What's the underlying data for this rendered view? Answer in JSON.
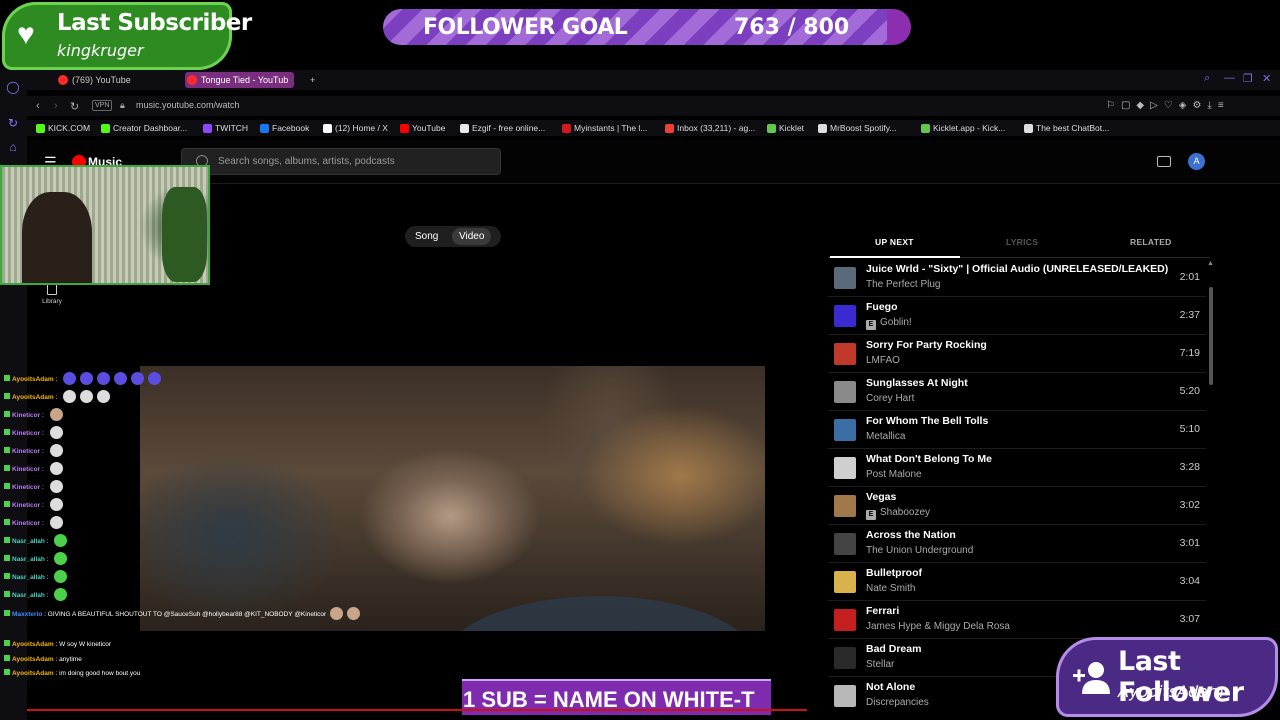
{
  "overlay": {
    "subscriber": {
      "title": "Last Subscriber",
      "name": "kingkruger"
    },
    "goal": {
      "title": "FOLLOWER GOAL",
      "current": 763,
      "target": 800,
      "count_text": "763 / 800"
    },
    "follower": {
      "title": "Last Follower",
      "name": "AyooitsAdam"
    },
    "banner": "1 SUB = NAME ON WHITE-T"
  },
  "browser": {
    "tabs": [
      {
        "label": "(769) YouTube",
        "active": false
      },
      {
        "label": "Tongue Tied - YouTub",
        "active": true
      }
    ],
    "url": "music.youtube.com/watch",
    "vpn": "VPN",
    "bookmarks": [
      {
        "label": "KICK.COM",
        "color": "#53fc18"
      },
      {
        "label": "Creator Dashboar...",
        "color": "#53fc18"
      },
      {
        "label": "TWITCH",
        "color": "#9146ff"
      },
      {
        "label": "Facebook",
        "color": "#1877f2"
      },
      {
        "label": "(12) Home / X",
        "color": "#ffffff"
      },
      {
        "label": "YouTube",
        "color": "#ff0000"
      },
      {
        "label": "Ezgif - free online...",
        "color": "#e9e9e9"
      },
      {
        "label": "Myinstants | The l...",
        "color": "#d11a1a"
      },
      {
        "label": "Inbox (33,211) - ag...",
        "color": "#ea4335"
      },
      {
        "label": "Kicklet",
        "color": "#63c74d"
      },
      {
        "label": "MrBoost Spotify...",
        "color": "#dddddd"
      },
      {
        "label": "Kicklet.app - Kick...",
        "color": "#63c74d"
      },
      {
        "label": "The best ChatBot...",
        "color": "#dddddd"
      }
    ]
  },
  "ytmusic": {
    "logo": "Music",
    "search_placeholder": "Search songs, albums, artists, podcasts",
    "avatar_letter": "A",
    "library": "Library",
    "toggle": {
      "song": "Song",
      "video": "Video",
      "selected": "Video"
    },
    "panel_tabs": [
      "UP NEXT",
      "LYRICS",
      "RELATED"
    ],
    "queue": [
      {
        "title": "Juice Wrld - \"Sixty\" | Official Audio (UNRELEASED/LEAKED)",
        "artist": "The Perfect Plug",
        "explicit": false,
        "duration": "2:01",
        "thumb": "#5a6a7a"
      },
      {
        "title": "Fuego",
        "artist": "Goblin!",
        "explicit": true,
        "duration": "2:37",
        "thumb": "#3b2ad1"
      },
      {
        "title": "Sorry For Party Rocking",
        "artist": "LMFAO",
        "explicit": false,
        "duration": "7:19",
        "thumb": "#c0392b"
      },
      {
        "title": "Sunglasses At Night",
        "artist": "Corey Hart",
        "explicit": false,
        "duration": "5:20",
        "thumb": "#8a8a8a"
      },
      {
        "title": "For Whom The Bell Tolls",
        "artist": "Metallica",
        "explicit": false,
        "duration": "5:10",
        "thumb": "#3a6ea5"
      },
      {
        "title": "What Don't Belong To Me",
        "artist": "Post Malone",
        "explicit": false,
        "duration": "3:28",
        "thumb": "#cfcfcf"
      },
      {
        "title": "Vegas",
        "artist": "Shaboozey",
        "explicit": true,
        "duration": "3:02",
        "thumb": "#a0784a"
      },
      {
        "title": "Across the Nation",
        "artist": "The Union Underground",
        "explicit": false,
        "duration": "3:01",
        "thumb": "#444444"
      },
      {
        "title": "Bulletproof",
        "artist": "Nate Smith",
        "explicit": false,
        "duration": "3:04",
        "thumb": "#d8b24a"
      },
      {
        "title": "Ferrari",
        "artist": "James Hype & Miggy Dela Rosa",
        "explicit": false,
        "duration": "3:07",
        "thumb": "#c41e1e"
      },
      {
        "title": "Bad Dream",
        "artist": "Stellar",
        "explicit": false,
        "duration": "",
        "thumb": "#2a2a2a"
      },
      {
        "title": "Not Alone",
        "artist": "Discrepancies",
        "explicit": false,
        "duration": "",
        "thumb": "#b8b8b8"
      }
    ]
  },
  "chat": [
    {
      "user": "AyooitsAdam",
      "color": "#f5b700",
      "text": "",
      "emotes": 6,
      "emote_color": "#5a4de0"
    },
    {
      "user": "AyooitsAdam",
      "color": "#f5b700",
      "text": "",
      "emotes": 3,
      "emote_color": "#dddddd"
    },
    {
      "user": "Kineticor",
      "color": "#b77cf2",
      "text": "",
      "emotes": 1,
      "emote_color": "#c9a58a"
    },
    {
      "user": "Kineticor",
      "color": "#b77cf2",
      "text": "",
      "emotes": 1,
      "emote_color": "#dddddd"
    },
    {
      "user": "Kineticor",
      "color": "#b77cf2",
      "text": "",
      "emotes": 1,
      "emote_color": "#dddddd"
    },
    {
      "user": "Kineticor",
      "color": "#b77cf2",
      "text": "",
      "emotes": 1,
      "emote_color": "#dddddd"
    },
    {
      "user": "Kineticor",
      "color": "#b77cf2",
      "text": "",
      "emotes": 1,
      "emote_color": "#dddddd"
    },
    {
      "user": "Kineticor",
      "color": "#b77cf2",
      "text": "",
      "emotes": 1,
      "emote_color": "#dddddd"
    },
    {
      "user": "Kineticor",
      "color": "#b77cf2",
      "text": "",
      "emotes": 1,
      "emote_color": "#dddddd"
    },
    {
      "user": "Nasr_allah",
      "color": "#4bd1c0",
      "text": "",
      "emotes": 1,
      "emote_color": "#4bd14b"
    },
    {
      "user": "Nasr_allah",
      "color": "#4bd1c0",
      "text": "",
      "emotes": 1,
      "emote_color": "#4bd14b"
    },
    {
      "user": "Nasr_allah",
      "color": "#4bd1c0",
      "text": "",
      "emotes": 1,
      "emote_color": "#4bd14b"
    },
    {
      "user": "Nasr_allah",
      "color": "#4bd1c0",
      "text": "",
      "emotes": 1,
      "emote_color": "#4bd14b"
    },
    {
      "user": "Maxxterio",
      "color": "#3a8cff",
      "text": "GIVING A BEAUTIFUL SHOUTOUT TO @SauceSuh @hollybear88 @KIT_NOBODY @Kineticor",
      "emotes": 2,
      "emote_color": "#c9a58a"
    },
    {
      "user": "AyooitsAdam",
      "color": "#f5b700",
      "text": "W soy W kineticor",
      "emotes": 0,
      "emote_color": ""
    },
    {
      "user": "AyooitsAdam",
      "color": "#f5b700",
      "text": "anytime",
      "emotes": 0,
      "emote_color": ""
    },
    {
      "user": "AyooitsAdam",
      "color": "#f5b700",
      "text": "im doing good how bout you",
      "emotes": 0,
      "emote_color": ""
    }
  ]
}
